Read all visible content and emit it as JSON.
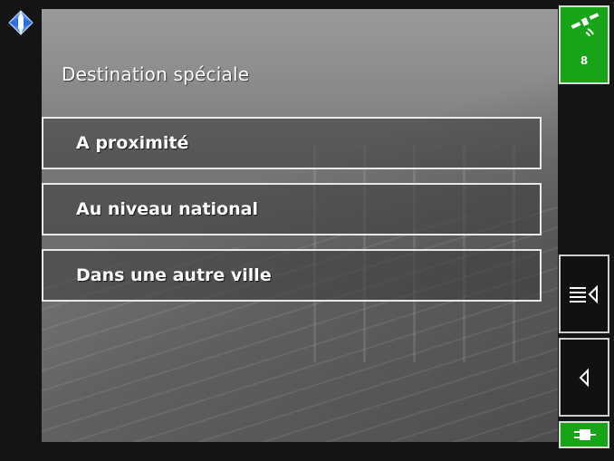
{
  "screen": {
    "title": "Destination spéciale"
  },
  "menu": {
    "items": [
      {
        "label": "A proximité"
      },
      {
        "label": "Au niveau national"
      },
      {
        "label": "Dans une autre ville"
      }
    ]
  },
  "status": {
    "gps_satellites": "8",
    "gps_icon": "satellite-icon",
    "power_icon": "plug-icon",
    "compass_icon": "compass-arrows-icon"
  },
  "side_buttons": {
    "list_icon": "list-back-icon",
    "back_icon": "back-triangle-icon"
  },
  "colors": {
    "accent_green": "#18a418",
    "compass_blue": "#4a8cff"
  }
}
